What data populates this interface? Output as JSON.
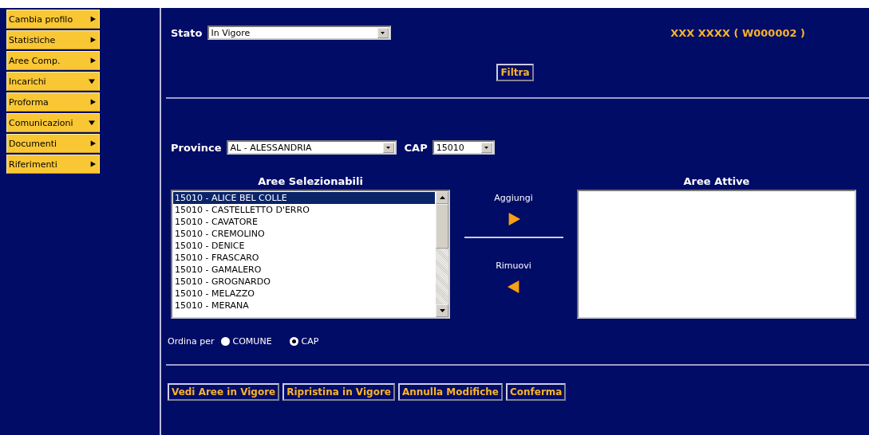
{
  "sidebar": {
    "items": [
      {
        "label": "Cambia profilo",
        "expanded": false
      },
      {
        "label": "Statistiche",
        "expanded": false
      },
      {
        "label": "Aree Comp.",
        "expanded": false
      },
      {
        "label": "Incarichi",
        "expanded": true
      },
      {
        "label": "Proforma",
        "expanded": false
      },
      {
        "label": "Comunicazioni",
        "expanded": true
      },
      {
        "label": "Documenti",
        "expanded": false
      },
      {
        "label": "Riferimenti",
        "expanded": false
      }
    ]
  },
  "filter": {
    "label": "Stato",
    "value": "In Vigore",
    "user": "XXX XXXX ( W000002 )",
    "button": "Filtra"
  },
  "selection": {
    "province_label": "Province",
    "province_value": "AL - ALESSANDRIA",
    "cap_label": "CAP",
    "cap_value": "15010",
    "available_title": "Aree Selezionabili",
    "available": [
      {
        "label": "15010 - ALICE BEL COLLE",
        "selected": true
      },
      {
        "label": "15010 - CASTELLETTO D'ERRO",
        "selected": false
      },
      {
        "label": "15010 - CAVATORE",
        "selected": false
      },
      {
        "label": "15010 - CREMOLINO",
        "selected": false
      },
      {
        "label": "15010 - DENICE",
        "selected": false
      },
      {
        "label": "15010 - FRASCARO",
        "selected": false
      },
      {
        "label": "15010 - GAMALERO",
        "selected": false
      },
      {
        "label": "15010 - GROGNARDO",
        "selected": false
      },
      {
        "label": "15010 - MELAZZO",
        "selected": false
      },
      {
        "label": "15010 - MERANA",
        "selected": false
      }
    ],
    "add_label": "Aggiungi",
    "remove_label": "Rimuovi",
    "active_title": "Aree Attive",
    "sort_label": "Ordina per",
    "sort_options": [
      {
        "label": "COMUNE",
        "selected": false
      },
      {
        "label": "CAP",
        "selected": true
      }
    ]
  },
  "buttons": [
    "Vedi Aree in Vigore",
    "Ripristina in Vigore",
    "Annulla Modifiche",
    "Conferma"
  ]
}
